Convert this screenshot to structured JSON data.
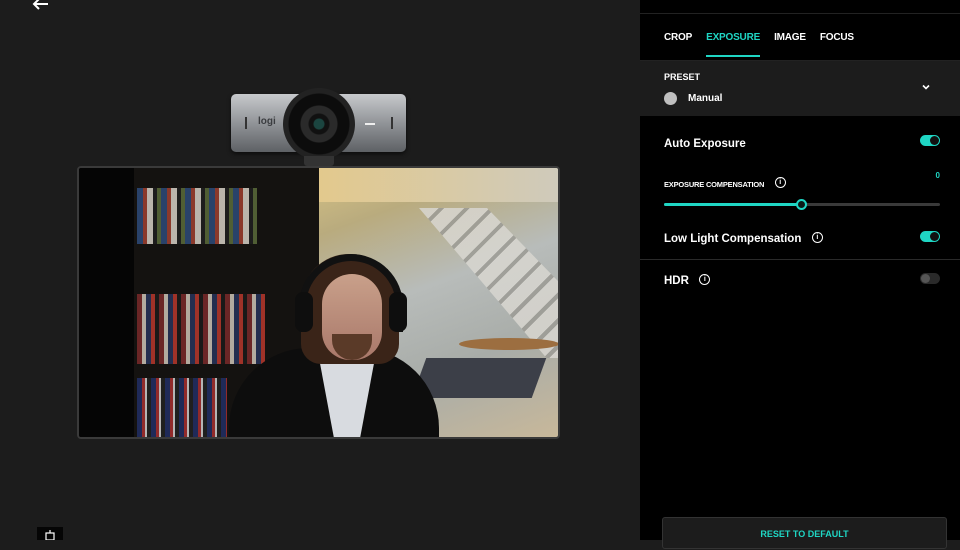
{
  "nav": {
    "back_icon": "arrow-left-icon",
    "bottom_icon": "device-icon"
  },
  "camera": {
    "brand_label": "logi",
    "preview_alt": "Live webcam preview"
  },
  "panel": {
    "tabs": [
      {
        "label": "CROP",
        "active": false
      },
      {
        "label": "EXPOSURE",
        "active": true
      },
      {
        "label": "IMAGE",
        "active": false
      },
      {
        "label": "FOCUS",
        "active": false
      }
    ],
    "preset": {
      "label": "PRESET",
      "value": "Manual",
      "expand_icon": "chevron-down-icon"
    },
    "auto_exposure": {
      "label": "Auto Exposure",
      "enabled": true
    },
    "exposure_compensation": {
      "label": "EXPOSURE COMPENSATION",
      "value": "0",
      "position": 0.5
    },
    "low_light": {
      "label": "Low Light Compensation",
      "enabled": true
    },
    "hdr": {
      "label": "HDR",
      "enabled": false
    },
    "info_glyph": "i",
    "reset_label": "RESET TO DEFAULT"
  },
  "colors": {
    "accent": "#1fd6c4",
    "panel_bg": "#000000",
    "app_bg": "#1c1c1c"
  }
}
